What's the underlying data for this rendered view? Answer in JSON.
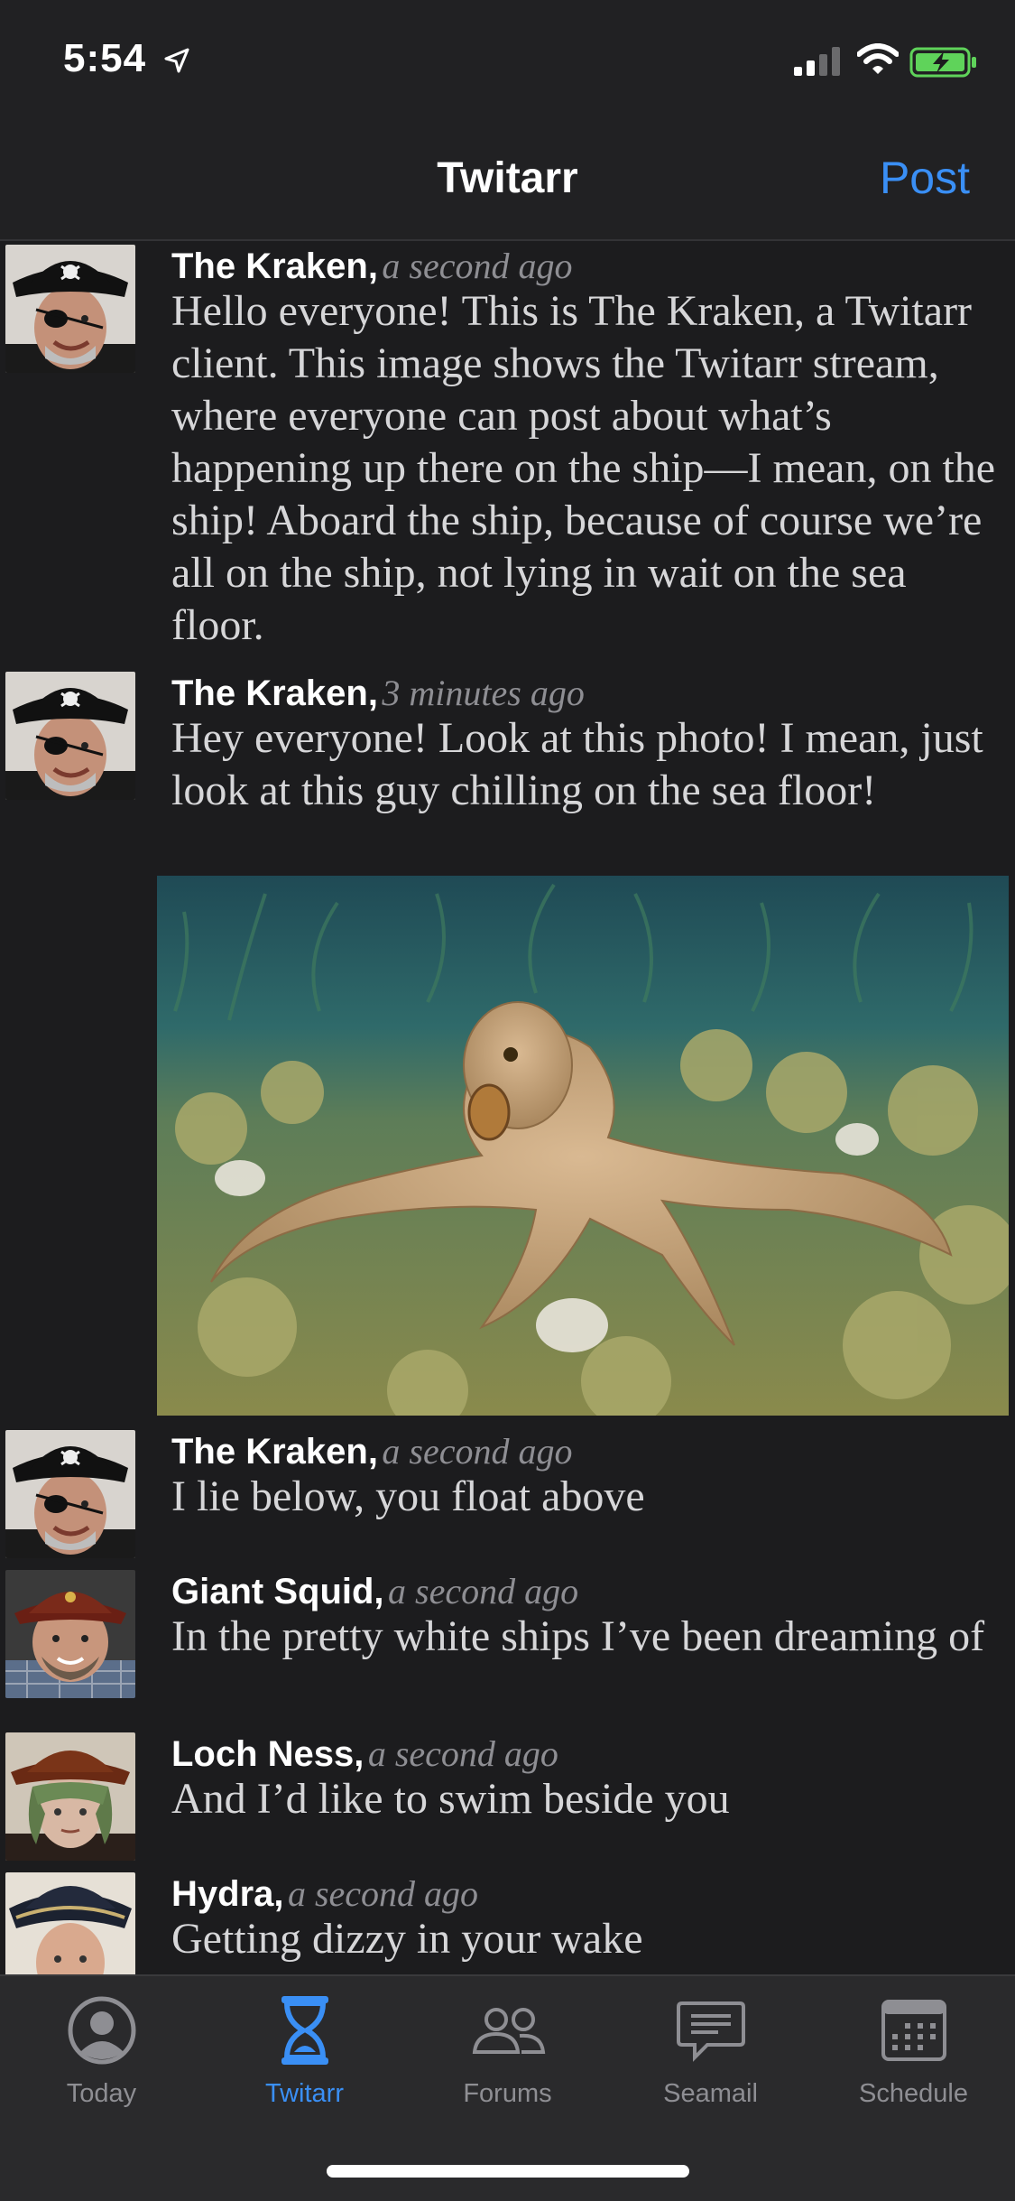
{
  "status": {
    "time": "5:54"
  },
  "nav": {
    "title": "Twitarr",
    "post_label": "Post"
  },
  "posts": [
    {
      "author": "The Kraken,",
      "ago": "a second ago",
      "text": "Hello everyone! This is The Kraken, a Twitarr client. This image shows the Twitarr stream, where everyone can post about what’s happening up there on the ship—I mean, on the ship! Aboard the ship, because of course we’re all on the ship, not lying in wait on the sea floor."
    },
    {
      "author": "The Kraken,",
      "ago": "3 minutes ago",
      "text": "Hey everyone! Look at this photo! I mean, just look at this guy chilling on the sea floor!"
    },
    {
      "author": "The Kraken,",
      "ago": "a second ago",
      "text": "I lie below, you float above"
    },
    {
      "author": "Giant Squid,",
      "ago": "a second ago",
      "text": "In the pretty white ships I’ve been dreaming of"
    },
    {
      "author": "Loch Ness,",
      "ago": "a second ago",
      "text": "And I’d like to swim beside you"
    },
    {
      "author": "Hydra,",
      "ago": "a second ago",
      "text": "Getting dizzy in your wake"
    }
  ],
  "tabs": [
    {
      "label": "Today",
      "icon": "person-circle-icon",
      "active": false
    },
    {
      "label": "Twitarr",
      "icon": "hourglass-icon",
      "active": true
    },
    {
      "label": "Forums",
      "icon": "people-icon",
      "active": false
    },
    {
      "label": "Seamail",
      "icon": "message-icon",
      "active": false
    },
    {
      "label": "Schedule",
      "icon": "calendar-icon",
      "active": false
    }
  ],
  "colors": {
    "accent": "#3a8ff5",
    "background": "#1c1c1e",
    "battery": "#5fd35a"
  }
}
